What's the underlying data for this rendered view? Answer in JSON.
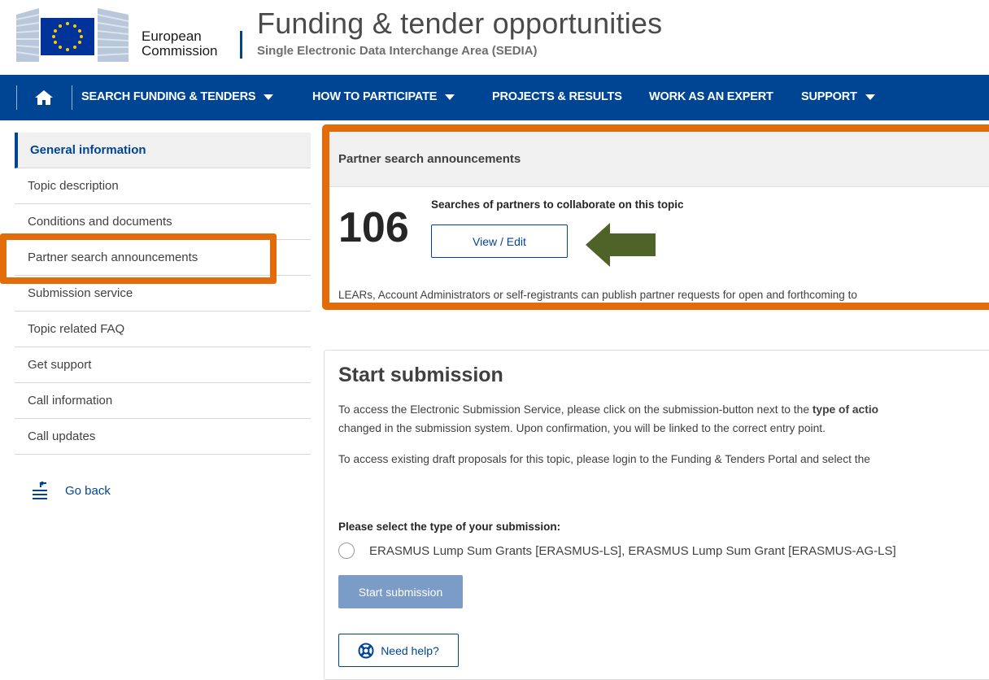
{
  "header": {
    "ec_line1": "European",
    "ec_line2": "Commission",
    "title": "Funding & tender opportunities",
    "subtitle": "Single Electronic Data Interchange Area (SEDIA)"
  },
  "nav": {
    "home_icon": "home-icon",
    "items": [
      {
        "label": "SEARCH FUNDING & TENDERS",
        "has_dropdown": true
      },
      {
        "label": "HOW TO PARTICIPATE",
        "has_dropdown": true
      },
      {
        "label": "PROJECTS & RESULTS",
        "has_dropdown": false
      },
      {
        "label": "WORK AS AN EXPERT",
        "has_dropdown": false
      },
      {
        "label": "SUPPORT",
        "has_dropdown": true
      }
    ]
  },
  "sidebar": {
    "items": [
      {
        "label": "General information",
        "active": true
      },
      {
        "label": "Topic description"
      },
      {
        "label": "Conditions and documents"
      },
      {
        "label": "Partner search announcements"
      },
      {
        "label": "Submission service"
      },
      {
        "label": "Topic related FAQ"
      },
      {
        "label": "Get support"
      },
      {
        "label": "Call information"
      },
      {
        "label": "Call updates"
      }
    ],
    "go_back": "Go back"
  },
  "partner": {
    "header": "Partner search announcements",
    "count": "106",
    "searches_text": "Searches of partners to collaborate on this topic",
    "view_edit": "View / Edit",
    "lears_text": "LEARs, Account Administrators or self-registrants can publish partner requests for open and forthcoming to"
  },
  "submission": {
    "title": "Start submission",
    "para1_start": "To access the Electronic Submission Service, please click on the submission-button next to the ",
    "para1_bold": "type of actio",
    "para1_line2": "changed in the submission system. Upon confirmation, you will be linked to the correct entry point.",
    "para2": "To access existing draft proposals for this topic, please login to the Funding & Tenders Portal and select the",
    "select_label": "Please select the type of your submission:",
    "radio_option": "ERASMUS Lump Sum Grants [ERASMUS-LS], ERASMUS Lump Sum Grant [ERASMUS-AG-LS]",
    "start_button": "Start submission",
    "help_button": "Need help?"
  },
  "colors": {
    "brand_blue": "#004494",
    "highlight_orange": "#e36c0a",
    "arrow_green": "#4f6228"
  }
}
